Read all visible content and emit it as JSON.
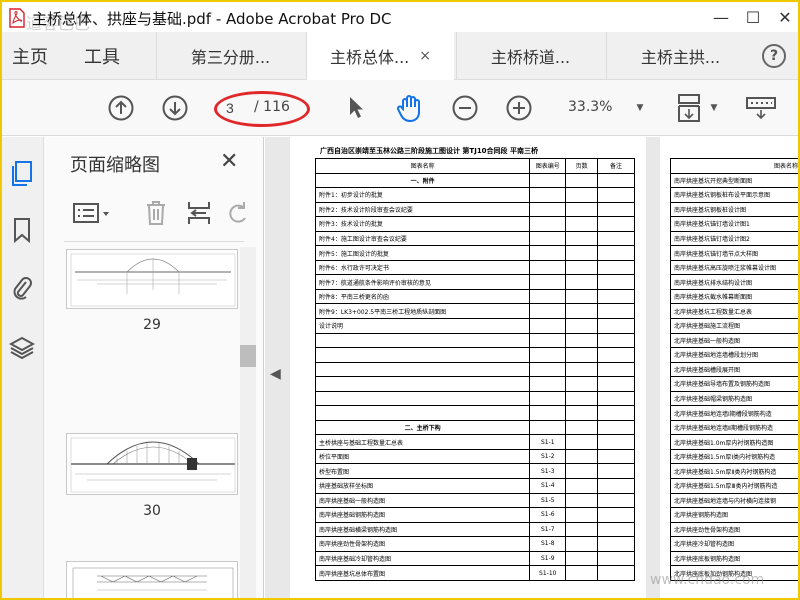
{
  "window": {
    "title": "主桥总体、拱座与基础.pdf - Adobe Acrobat Pro DC",
    "minimize": "—",
    "maximize": "☐",
    "close": "✕"
  },
  "watermarks": {
    "top_left": "道客巴巴",
    "bottom_right": "www.chdao.com"
  },
  "tabs": {
    "home": "主页",
    "tools": "工具",
    "documents": [
      {
        "label": "第三分册..."
      },
      {
        "label": "主桥总体..."
      },
      {
        "label": "主桥桥道..."
      },
      {
        "label": "主桥主拱..."
      }
    ],
    "tab_close": "×",
    "help": "?"
  },
  "toolbar": {
    "current_page": "3",
    "total_pages": "/ 116",
    "zoom": "33.3%",
    "icons": [
      "previous-page-icon",
      "next-page-icon",
      "select-arrow-icon",
      "hand-tool-icon",
      "zoom-out-icon",
      "zoom-in-icon",
      "page-fit-icon",
      "keyboard-icon"
    ]
  },
  "panel": {
    "title": "页面缩略图",
    "close": "✕",
    "thumbnails": [
      {
        "number": "29"
      },
      {
        "number": "30"
      }
    ]
  },
  "document": {
    "heading": "广西自治区崇靖至玉林公路三阶段施工图设计  第TJ10合同段  平南三桥",
    "table1": {
      "headers": [
        "图表名称",
        "图表编号",
        "页数",
        "备注"
      ],
      "rows": [
        {
          "name": "一、附件",
          "code": "",
          "section": true
        },
        {
          "name": "附件1：初步设计的批复",
          "code": ""
        },
        {
          "name": "附件2：技术设计阶段审查会议纪要",
          "code": ""
        },
        {
          "name": "附件3：技术设计的批复",
          "code": ""
        },
        {
          "name": "附件4：施工图设计审查会议纪要",
          "code": ""
        },
        {
          "name": "附件5：施工图设计的批复",
          "code": ""
        },
        {
          "name": "附件6：水行政许可决定书",
          "code": ""
        },
        {
          "name": "附件7：航道通航条件影响评价审核的意见",
          "code": ""
        },
        {
          "name": "附件8：平南三桥更名的函",
          "code": ""
        },
        {
          "name": "附件9：LK3+002.5平南三桥工程地质纵剖面图",
          "code": ""
        },
        {
          "name": "设计说明",
          "code": ""
        },
        {
          "name": "",
          "code": ""
        },
        {
          "name": "",
          "code": ""
        },
        {
          "name": "",
          "code": ""
        },
        {
          "name": "",
          "code": ""
        },
        {
          "name": "",
          "code": ""
        },
        {
          "name": "",
          "code": ""
        },
        {
          "name": "二、主桥下构",
          "code": "",
          "section": true
        },
        {
          "name": "主桥拱座与基础工程数量汇总表",
          "code": "S1-1"
        },
        {
          "name": "桥位平面图",
          "code": "S1-2"
        },
        {
          "name": "桥型布置图",
          "code": "S1-3"
        },
        {
          "name": "拱座基础放样坐标图",
          "code": "S1-4"
        },
        {
          "name": "南岸拱座基础一般构造图",
          "code": "S1-5"
        },
        {
          "name": "南岸拱座基础钢筋构造图",
          "code": "S1-6"
        },
        {
          "name": "南岸拱座基础横梁钢筋构造图",
          "code": "S1-7"
        },
        {
          "name": "南岸拱座劲性骨架构造图",
          "code": "S1-8"
        },
        {
          "name": "南岸拱座基础冷却管构造图",
          "code": "S1-9"
        },
        {
          "name": "南岸拱座基坑总体布置图",
          "code": "S1-10"
        }
      ]
    },
    "table2": {
      "header": "图表名称",
      "rows": [
        "南岸拱座基坑开挖典型断面图",
        "南岸拱座基坑钢板桩布设平面示意图",
        "南岸拱座基坑钢板桩设计图",
        "南岸拱座基坑锚钉墙设计图1",
        "南岸拱座基坑锚钉墙设计图2",
        "南岸拱座基坑锚钉墙节点大样图",
        "南岸拱座基坑高压旋喷注浆帷幕设计图",
        "南岸拱座基坑排水结构设计图",
        "南岸拱座基坑截水帷幕断面图",
        "北岸拱座基坑工程数量汇总表",
        "北岸拱座基础施工流程图",
        "北岸拱座基础一般构造图",
        "北岸拱座基础地连墙槽段划分图",
        "北岸拱座基础槽段展开图",
        "北岸拱座基础导墙布置及钢筋构造图",
        "北岸拱座基础帽梁钢筋构造图",
        "北岸拱座基础地连墙Ⅰ期槽段钢筋构造",
        "北岸拱座基础地连墙Ⅱ期槽段钢筋构造",
        "北岸拱座基础1.0m厚内衬钢筋构造图",
        "北岸拱座基础1.5m厚Ⅰ类内衬钢筋构造",
        "北岸拱座基础1.5m厚Ⅱ类内衬钢筋构造",
        "北岸拱座基础1.5m厚Ⅲ类内衬钢筋构造",
        "北岸拱座基础地连墙与内衬横向连接钢",
        "北岸拱座钢筋构造图",
        "北岸拱座劲性骨架构造图",
        "北岸拱座冷却管构造图",
        "北岸拱座底板钢筋构造图",
        "北岸拱座底板加劲钢筋构造图"
      ]
    }
  },
  "colors": {
    "highlight_oval": "#e0282a",
    "window_border": "#f0c800",
    "acrobat_red": "#d8202a",
    "accent_blue": "#1473e6"
  }
}
